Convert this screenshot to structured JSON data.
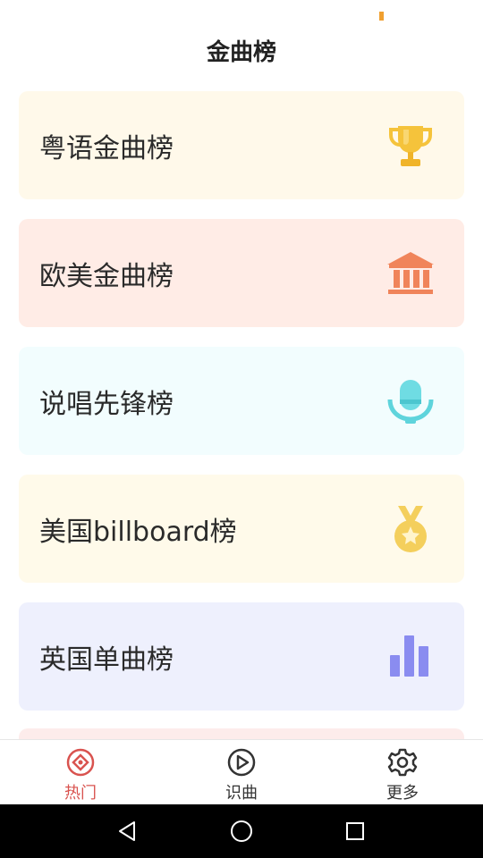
{
  "header": {
    "title": "金曲榜"
  },
  "cards": [
    {
      "label": "粤语金曲榜",
      "icon": "trophy-icon",
      "bg": "#fff9ea",
      "icon_color": "#f5c33b"
    },
    {
      "label": "欧美金曲榜",
      "icon": "museum-icon",
      "bg": "#ffece6",
      "icon_color": "#f0845a"
    },
    {
      "label": "说唱先锋榜",
      "icon": "microphone-icon",
      "bg": "#f2fdfe",
      "icon_color": "#5fd4dc"
    },
    {
      "label": "美国billboard榜",
      "icon": "medal-icon",
      "bg": "#fffaea",
      "icon_color": "#f4cf5c"
    },
    {
      "label": "英国单曲榜",
      "icon": "bar-chart-icon",
      "bg": "#eef0fd",
      "icon_color": "#8a8cf0"
    }
  ],
  "tabs": [
    {
      "label": "热门",
      "icon": "hot-icon",
      "active": true
    },
    {
      "label": "识曲",
      "icon": "play-circle-icon",
      "active": false
    },
    {
      "label": "更多",
      "icon": "gear-icon",
      "active": false
    }
  ],
  "colors": {
    "accent": "#d9534f",
    "peek_card": "#fdeceb"
  }
}
